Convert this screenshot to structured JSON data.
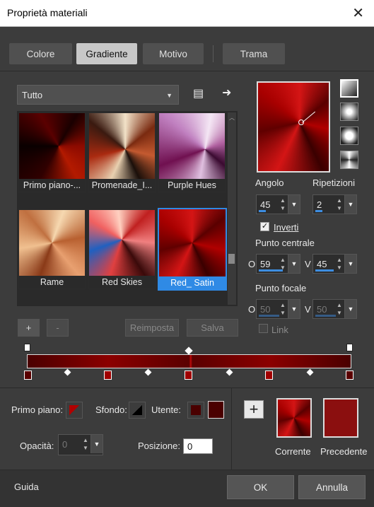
{
  "window": {
    "title": "Proprietà materiali",
    "close_glyph": "✕"
  },
  "tabs": [
    {
      "label": "Colore"
    },
    {
      "label": "Gradiente"
    },
    {
      "label": "Motivo"
    },
    {
      "label": "Trama"
    }
  ],
  "filter": {
    "value": "Tutto",
    "caret": "▼",
    "new_glyph": "▤",
    "arrow_glyph": "➜"
  },
  "gradients": [
    {
      "label": "Primo piano-..."
    },
    {
      "label": "Promenade_I..."
    },
    {
      "label": "Purple Hues"
    },
    {
      "label": "Rame"
    },
    {
      "label": "Red Skies"
    },
    {
      "label": "Red_ Satin"
    }
  ],
  "library_buttons": {
    "add": "+",
    "remove": "-",
    "reset": "Reimposta",
    "save": "Salva"
  },
  "controls": {
    "angle_label": "Angolo",
    "angle_value": "45",
    "repeat_label": "Ripetizioni",
    "repeat_value": "2",
    "invert_label": "Inverti",
    "invert_check": "✓",
    "center_label": "Punto centrale",
    "center_o_label": "O",
    "center_o": "59",
    "center_v_label": "V",
    "center_v": "45",
    "focal_label": "Punto focale",
    "focal_o_label": "O",
    "focal_o": "50",
    "focal_v_label": "V",
    "focal_v": "50",
    "link_label": "Link",
    "spin_up": "▲",
    "spin_down": "▼",
    "dd_caret": "▼"
  },
  "bottom": {
    "foreground_label": "Primo piano:",
    "background_label": "Sfondo:",
    "user_label": "Utente:",
    "opacity_label": "Opacità:",
    "opacity_value": "0",
    "position_label": "Posizione:",
    "position_value": "0",
    "add_glyph": "+",
    "current_label": "Corrente",
    "previous_label": "Precedente"
  },
  "footer": {
    "help": "Guida",
    "ok": "OK",
    "cancel": "Annulla"
  },
  "colors": {
    "accent": "#2f8ae5",
    "dark_red": "#5a0000",
    "red": "#8b0a0a",
    "previous": "#8b0f0f"
  }
}
